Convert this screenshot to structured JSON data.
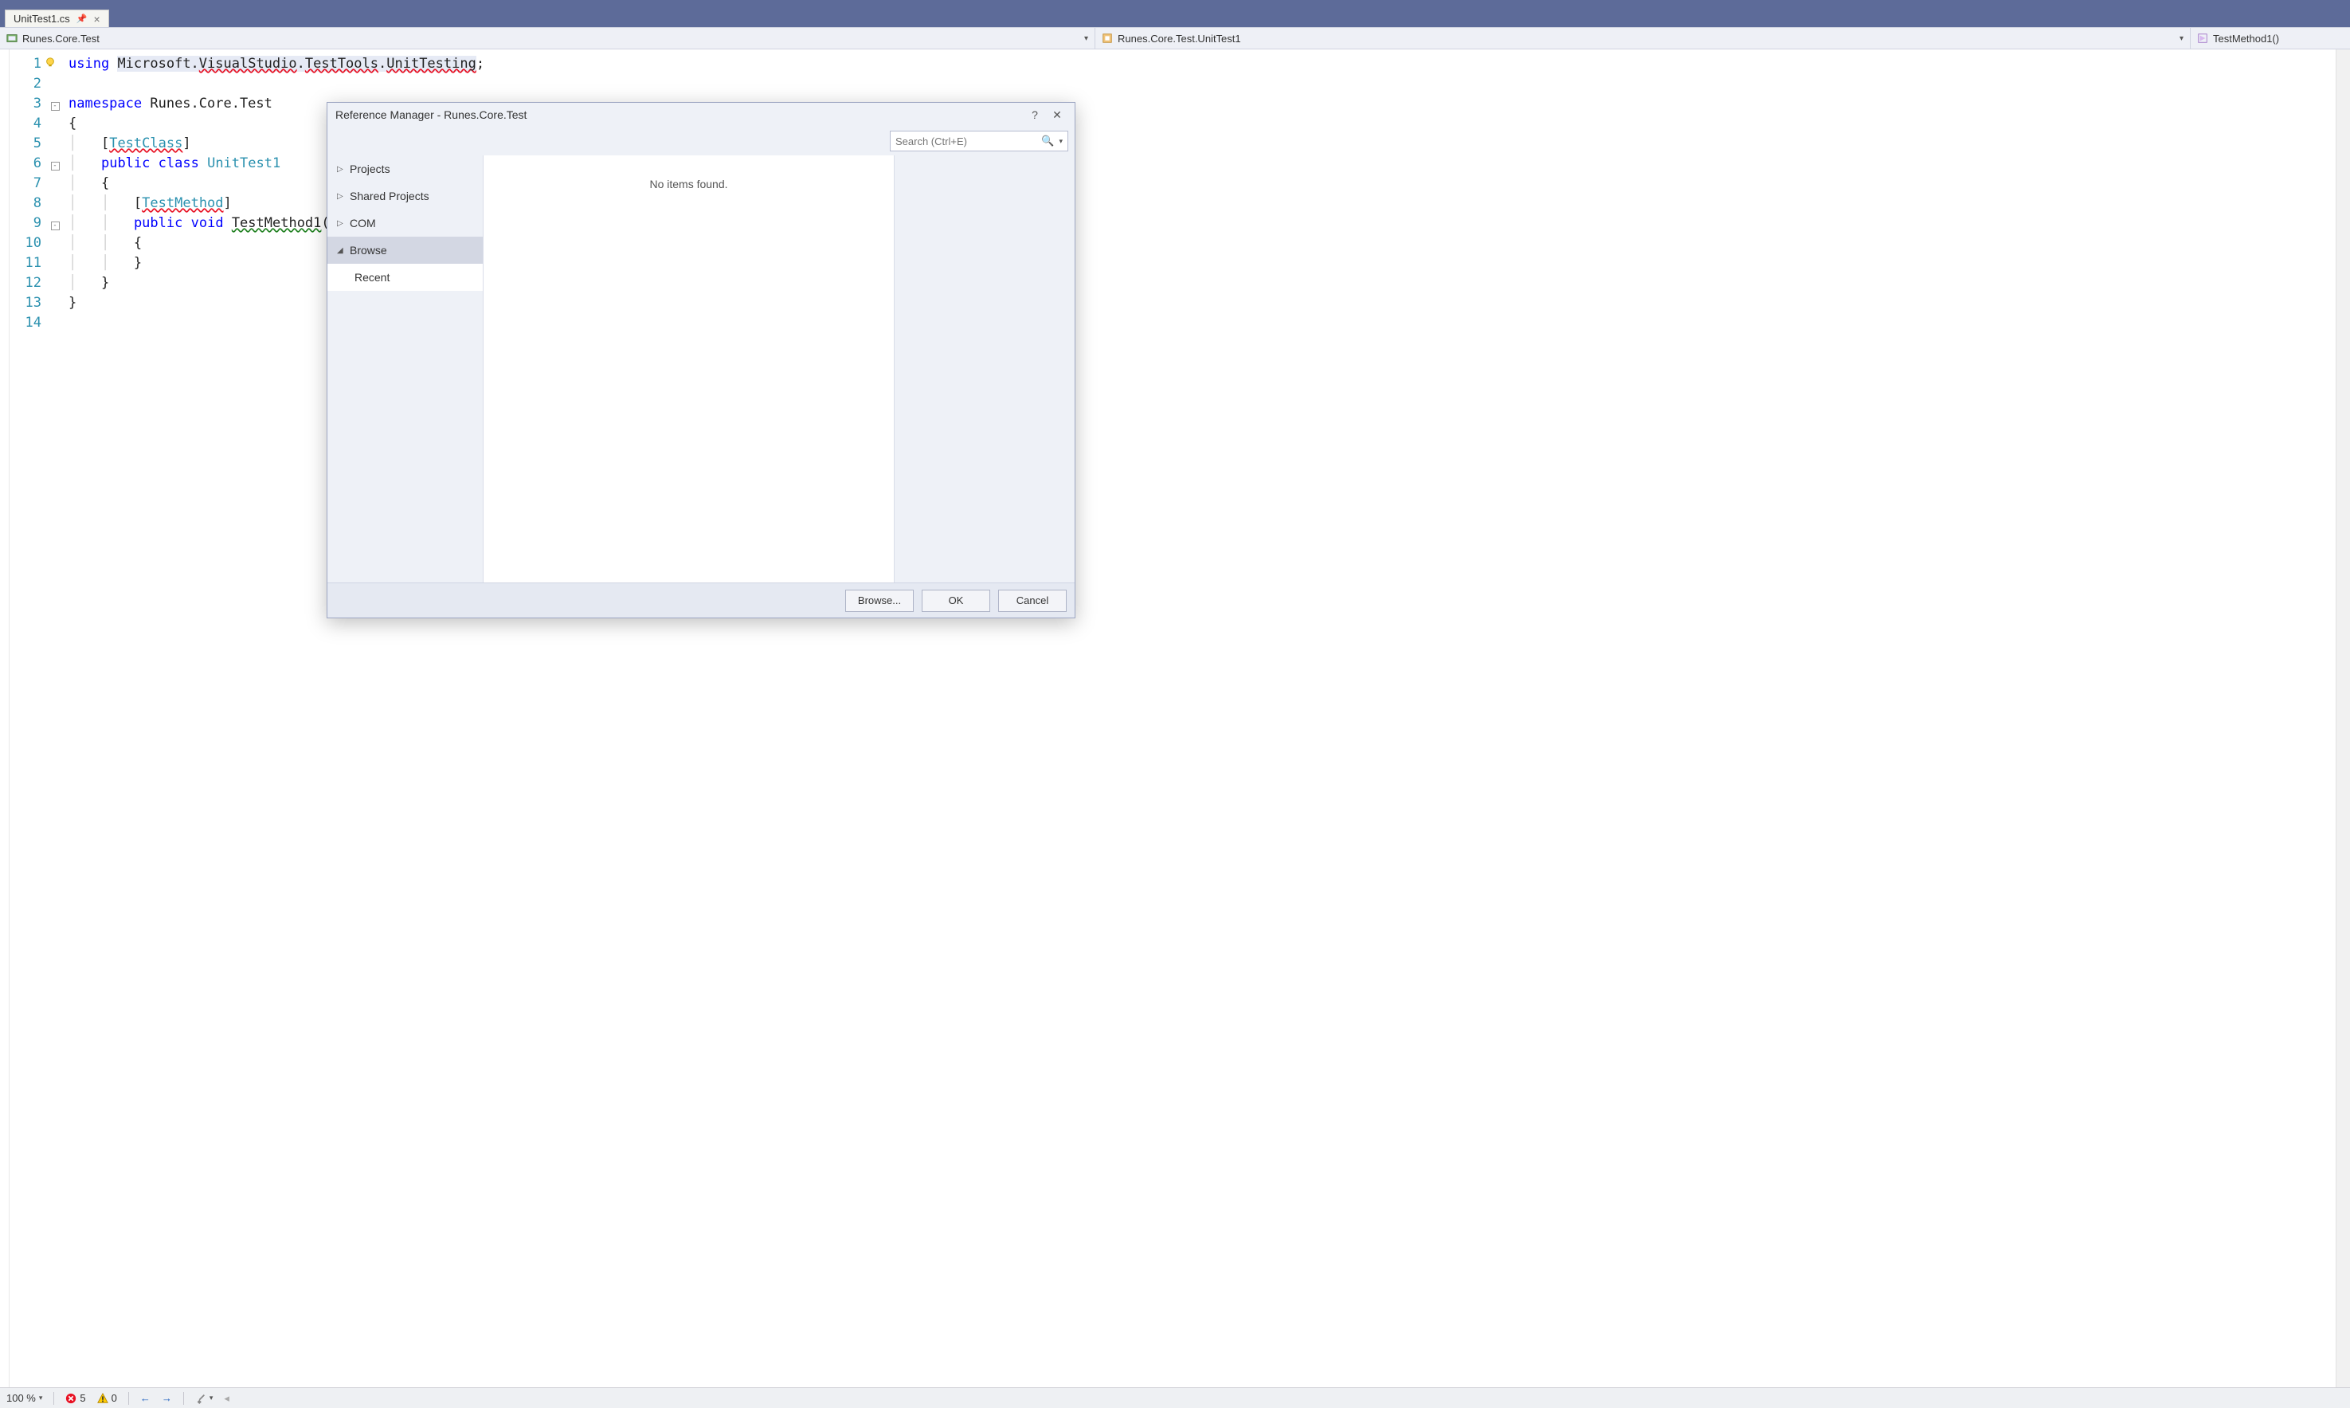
{
  "tab": {
    "filename": "UnitTest1.cs"
  },
  "nav": {
    "scope": "Runes.Core.Test",
    "class": "Runes.Core.Test.UnitTest1",
    "method": "TestMethod1()"
  },
  "code": {
    "lines": [
      "using Microsoft.VisualStudio.TestTools.UnitTesting;",
      "",
      "namespace Runes.Core.Test",
      "{",
      "    [TestClass]",
      "    public class UnitTest1",
      "    {",
      "        [TestMethod]",
      "        public void TestMethod1()",
      "        {",
      "        }",
      "    }",
      "}",
      ""
    ],
    "line_numbers": [
      1,
      2,
      3,
      4,
      5,
      6,
      7,
      8,
      9,
      10,
      11,
      12,
      13,
      14
    ]
  },
  "dialog": {
    "title": "Reference Manager - Runes.Core.Test",
    "search_placeholder": "Search (Ctrl+E)",
    "side_items": [
      {
        "label": "Projects",
        "expanded": false
      },
      {
        "label": "Shared Projects",
        "expanded": false
      },
      {
        "label": "COM",
        "expanded": false
      },
      {
        "label": "Browse",
        "expanded": true,
        "selected": true
      },
      {
        "label": "Recent",
        "sub": true
      }
    ],
    "empty_text": "No items found.",
    "buttons": {
      "browse": "Browse...",
      "ok": "OK",
      "cancel": "Cancel"
    }
  },
  "status": {
    "zoom": "100 %",
    "errors": "5",
    "warnings": "0"
  }
}
